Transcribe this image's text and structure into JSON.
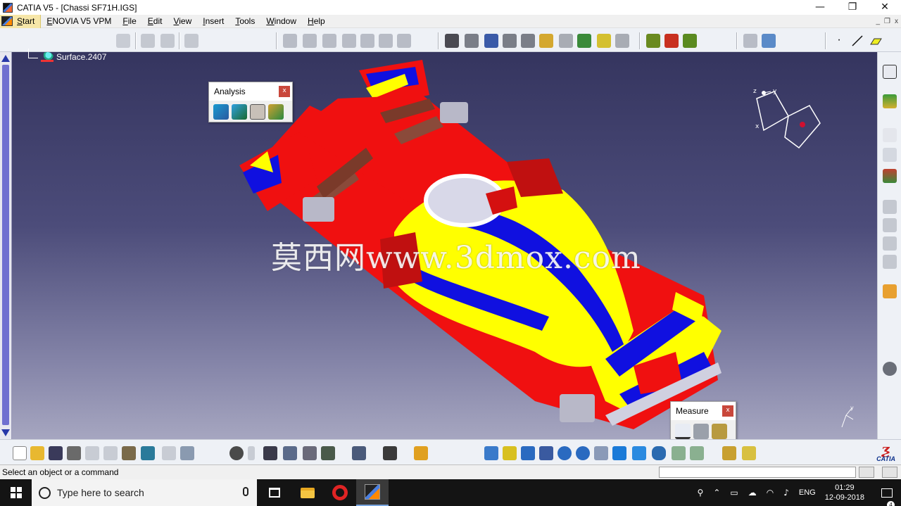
{
  "window": {
    "title": "CATIA V5 - [Chassi SF71H.IGS]",
    "controls": [
      "—",
      "❐",
      "✕"
    ],
    "mdi_controls": [
      "_",
      "❐",
      "x"
    ]
  },
  "menubar": {
    "start": "Start",
    "items": [
      "ENOVIA V5 VPM",
      "File",
      "Edit",
      "View",
      "Insert",
      "Tools",
      "Window",
      "Help"
    ]
  },
  "tree": {
    "node_label": "Surface.2407"
  },
  "watermark": "莫西网www.3dmox.com",
  "panels": {
    "analysis": {
      "title": "Analysis",
      "close": "x"
    },
    "measure": {
      "title": "Measure",
      "close": "x"
    }
  },
  "statusbar": {
    "message": "Select an object or a command",
    "command_input": ""
  },
  "taskbar": {
    "search_placeholder": "Type here to search",
    "language": "ENG",
    "time": "01:29",
    "date": "12-09-2018",
    "notification_count": "4"
  },
  "logo_text": "CATIA",
  "colors": {
    "viewport_top": "#35355f",
    "viewport_bottom": "#a6a6c0",
    "car_red": "#f01010",
    "car_yellow": "#ffff00",
    "car_blue": "#1010e0",
    "status_accent": "#c9473b"
  }
}
